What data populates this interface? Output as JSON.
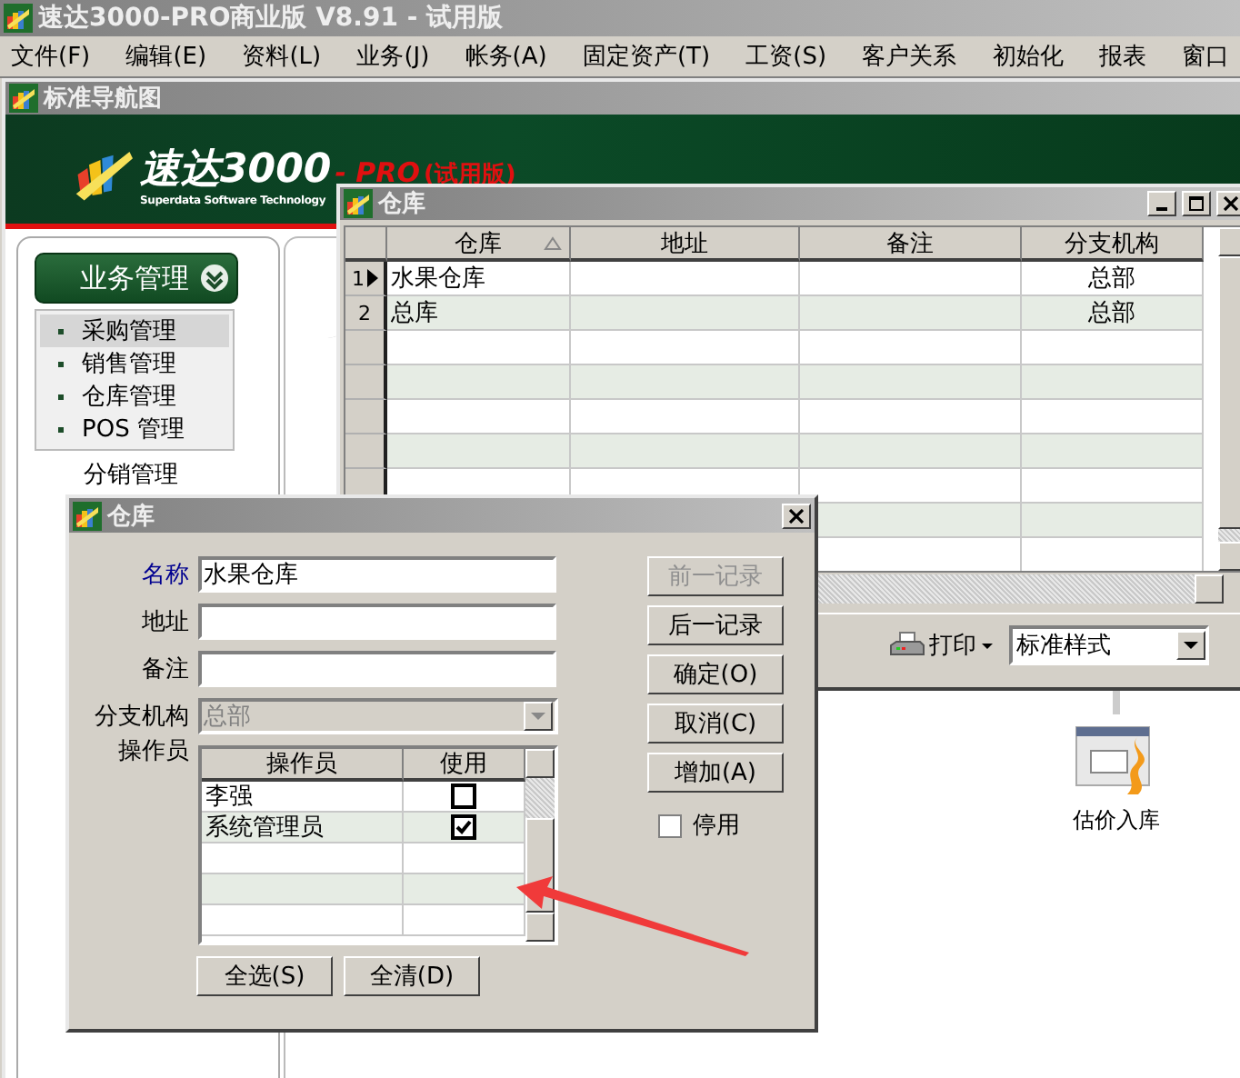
{
  "app": {
    "title": "速达3000-PRO商业版 V8.91 - 试用版"
  },
  "menu": [
    "文件(F)",
    "编辑(E)",
    "资料(L)",
    "业务(J)",
    "帐务(A)",
    "固定资产(T)",
    "工资(S)",
    "客户关系",
    "初始化",
    "报表",
    "窗口"
  ],
  "navigator": {
    "title": "标准导航图",
    "logo": {
      "name": "速达3000",
      "suffix": "- PRO",
      "edition": "(试用版)",
      "tagline": "Superdata Software Technology"
    },
    "group": {
      "label": "业务管理",
      "expanded": true
    },
    "items": [
      {
        "label": "采购管理",
        "selected": true
      },
      {
        "label": "销售管理",
        "selected": false
      },
      {
        "label": "仓库管理",
        "selected": false
      },
      {
        "label": "POS 管理",
        "selected": false
      }
    ],
    "next_group": "分销管理",
    "shortcut": {
      "label": "估价入库"
    }
  },
  "warehouse_list": {
    "title": "仓库",
    "columns": [
      {
        "label": "仓库",
        "sorted": true
      },
      {
        "label": "地址",
        "sorted": false
      },
      {
        "label": "备注",
        "sorted": false
      },
      {
        "label": "分支机构",
        "sorted": false
      }
    ],
    "rows": [
      {
        "number": "1",
        "current": true,
        "warehouse": "水果仓库",
        "branch": "总部"
      },
      {
        "number": "2",
        "current": false,
        "warehouse": "总库",
        "branch": "总部"
      }
    ],
    "print": "打印",
    "style": "标准样式"
  },
  "dialog": {
    "title": "仓库",
    "fields": [
      {
        "label": "名称",
        "value": "水果仓库",
        "required": true,
        "kind": "text"
      },
      {
        "label": "地址",
        "required": false,
        "kind": "text"
      },
      {
        "label": "备注",
        "required": false,
        "kind": "text"
      },
      {
        "label": "分支机构",
        "value": "总部",
        "required": false,
        "kind": "select",
        "disabled": true
      }
    ],
    "operators": {
      "label": "操作员",
      "columns": [
        "操作员",
        "使用"
      ],
      "rows": [
        {
          "name": "李强",
          "checked": false
        },
        {
          "name": "系统管理员",
          "checked": true
        }
      ]
    },
    "buttons": [
      {
        "label": "前一记录",
        "disabled": true
      },
      {
        "label": "后一记录",
        "disabled": false
      },
      {
        "label": "确定(O)",
        "disabled": false
      },
      {
        "label": "取消(C)",
        "disabled": false
      },
      {
        "label": "增加(A)",
        "disabled": false
      }
    ],
    "inactive": {
      "label": "停用",
      "checked": false
    },
    "bottom_buttons": [
      "全选(S)",
      "全清(D)"
    ]
  }
}
